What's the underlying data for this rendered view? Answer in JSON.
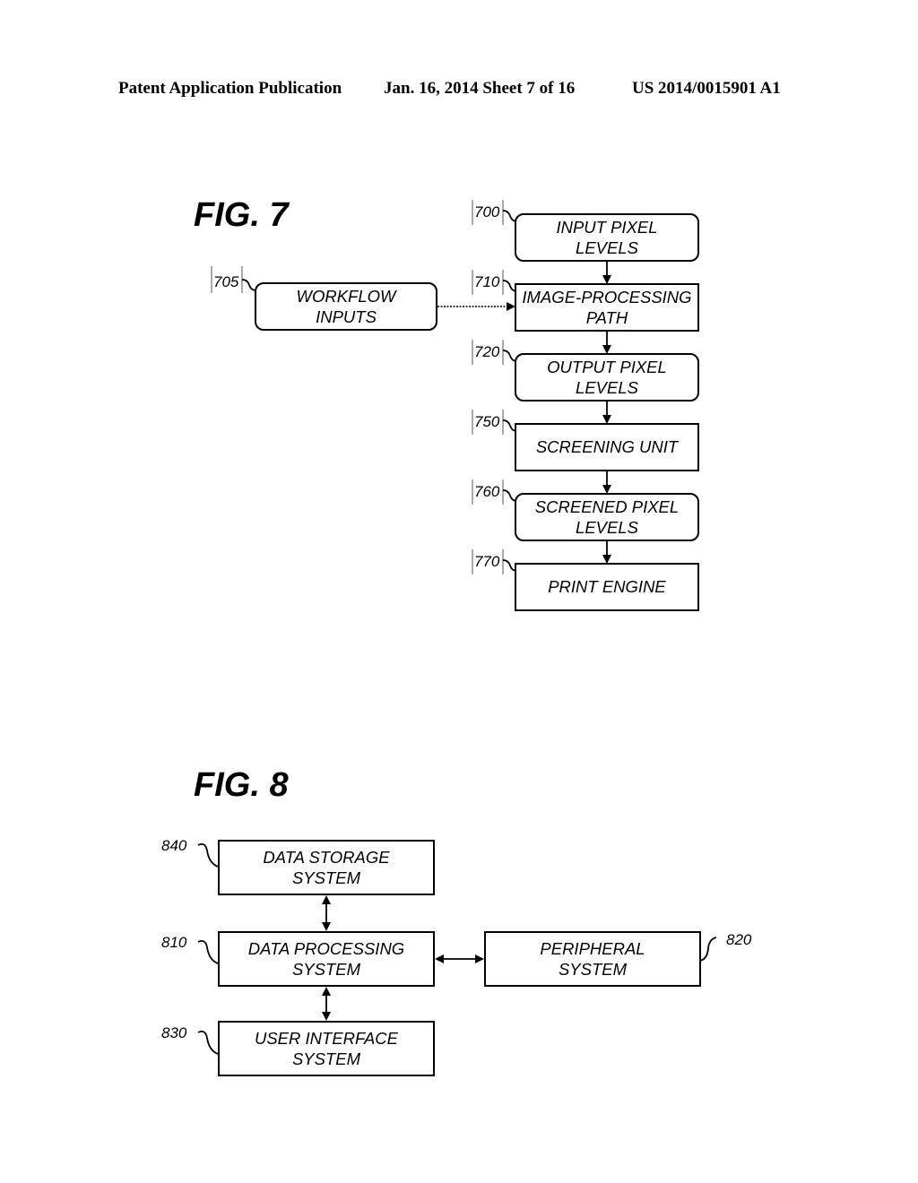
{
  "header": {
    "left": "Patent Application Publication",
    "middle": "Jan. 16, 2014  Sheet 7 of 16",
    "right": "US 2014/0015901 A1"
  },
  "fig7": {
    "title": "FIG. 7",
    "workflow": {
      "ref": "705",
      "lines": [
        "WORKFLOW",
        "INPUTS"
      ]
    },
    "chain": [
      {
        "ref": "700",
        "lines": [
          "INPUT PIXEL",
          "LEVELS"
        ],
        "rounded": true
      },
      {
        "ref": "710",
        "lines": [
          "IMAGE-PROCESSING",
          "PATH"
        ],
        "rounded": false
      },
      {
        "ref": "720",
        "lines": [
          "OUTPUT PIXEL",
          "LEVELS"
        ],
        "rounded": true
      },
      {
        "ref": "750",
        "lines": [
          "SCREENING UNIT"
        ],
        "rounded": false
      },
      {
        "ref": "760",
        "lines": [
          "SCREENED PIXEL",
          "LEVELS"
        ],
        "rounded": true
      },
      {
        "ref": "770",
        "lines": [
          "PRINT ENGINE"
        ],
        "rounded": false
      }
    ]
  },
  "fig8": {
    "title": "FIG. 8",
    "storage": {
      "ref": "840",
      "lines": [
        "DATA STORAGE",
        "SYSTEM"
      ]
    },
    "processing": {
      "ref": "810",
      "lines": [
        "DATA PROCESSING",
        "SYSTEM"
      ]
    },
    "peripheral": {
      "ref": "820",
      "lines": [
        "PERIPHERAL",
        "SYSTEM"
      ]
    },
    "ui": {
      "ref": "830",
      "lines": [
        "USER INTERFACE",
        "SYSTEM"
      ]
    }
  }
}
